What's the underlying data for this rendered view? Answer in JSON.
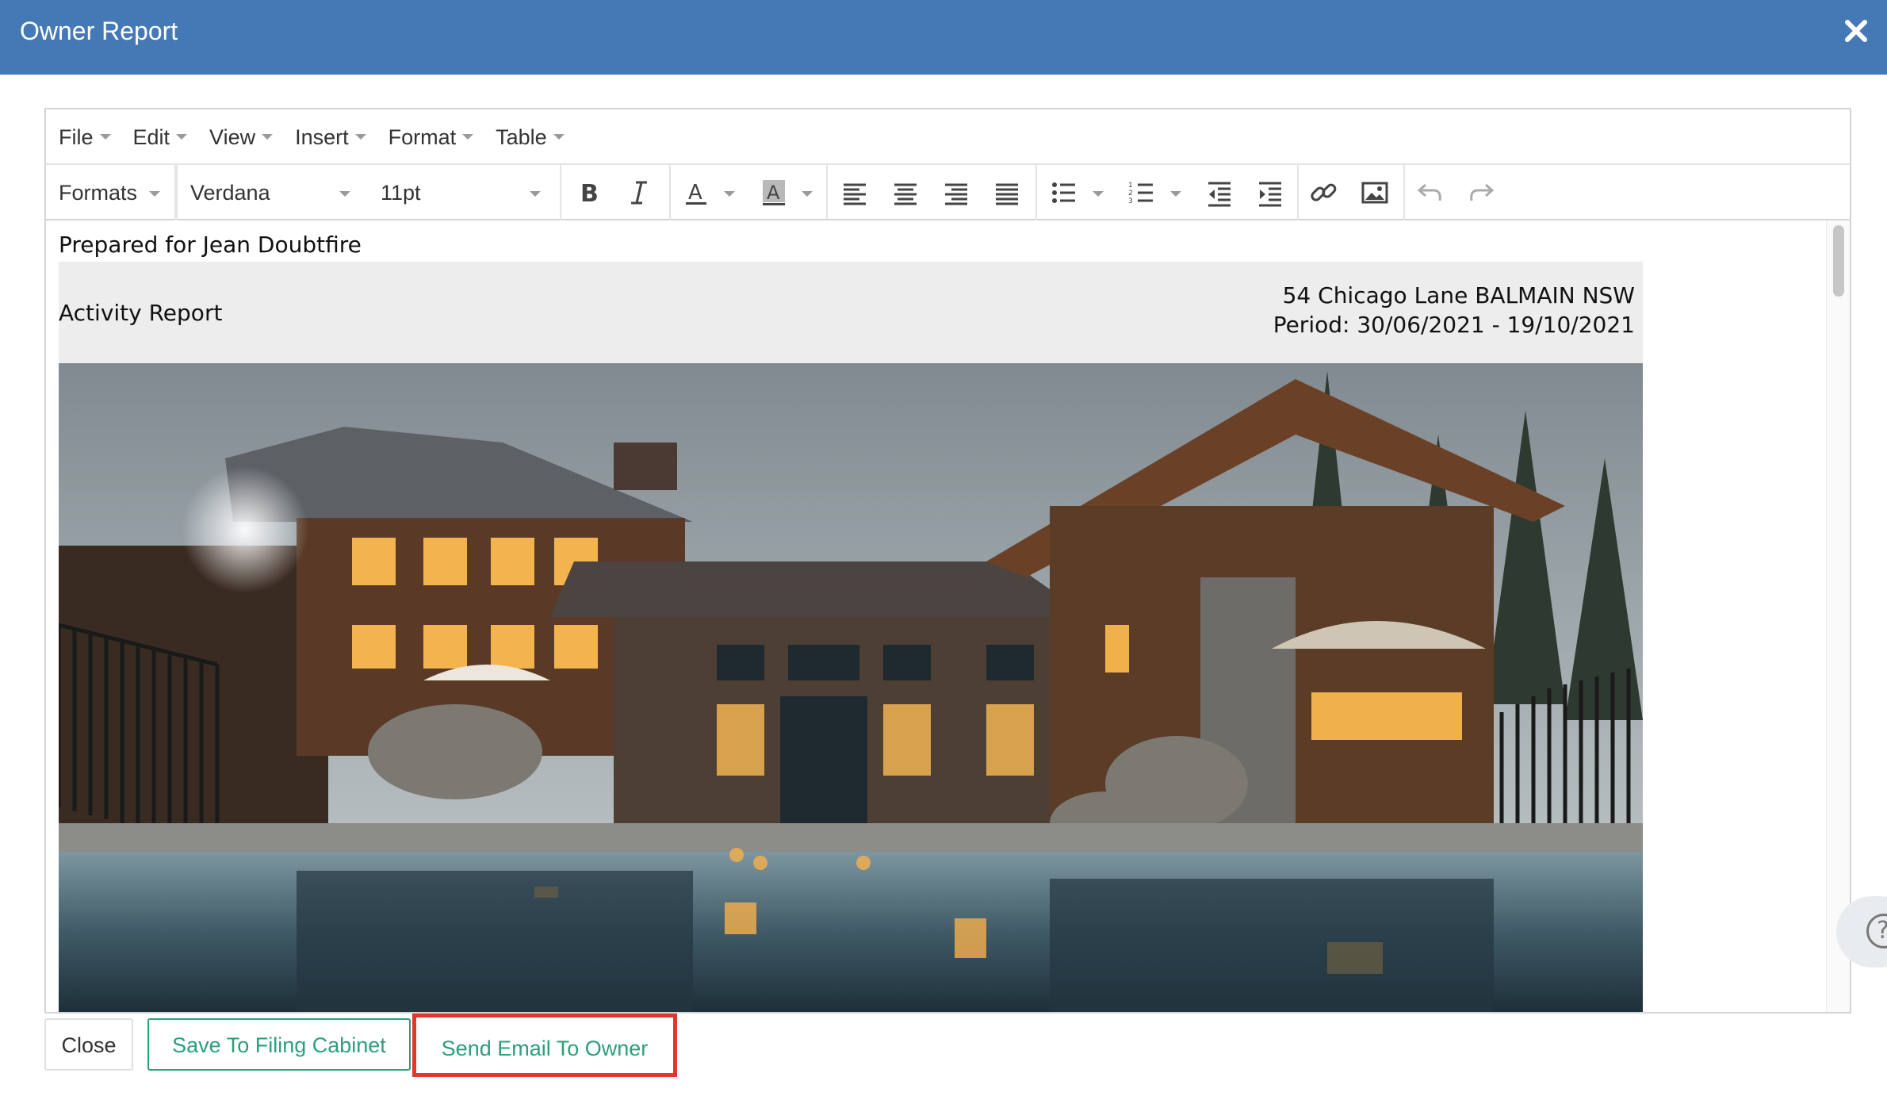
{
  "modal": {
    "title": "Owner Report"
  },
  "menubar": {
    "items": [
      "File",
      "Edit",
      "View",
      "Insert",
      "Format",
      "Table"
    ]
  },
  "toolbar": {
    "formats_label": "Formats",
    "font_family": "Verdana",
    "font_size": "11pt",
    "icons": [
      "bold-icon",
      "italic-icon",
      "text-color-icon",
      "background-color-icon",
      "align-left-icon",
      "align-center-icon",
      "align-right-icon",
      "align-justify-icon",
      "bullet-list-icon",
      "numbered-list-icon",
      "outdent-icon",
      "indent-icon",
      "link-icon",
      "image-icon",
      "undo-icon",
      "redo-icon"
    ]
  },
  "document": {
    "prepared_for": "Prepared for Jean Doubtfire",
    "report_title": "Activity Report",
    "address": "54 Chicago Lane BALMAIN NSW",
    "period": "Period: 30/06/2021 - 19/10/2021"
  },
  "footer": {
    "close_label": "Close",
    "save_label": "Save To Filing Cabinet",
    "send_label": "Send Email To Owner"
  },
  "colors": {
    "header": "#4479b6",
    "accent_green": "#2aa078",
    "highlight_red": "#e2382a"
  }
}
